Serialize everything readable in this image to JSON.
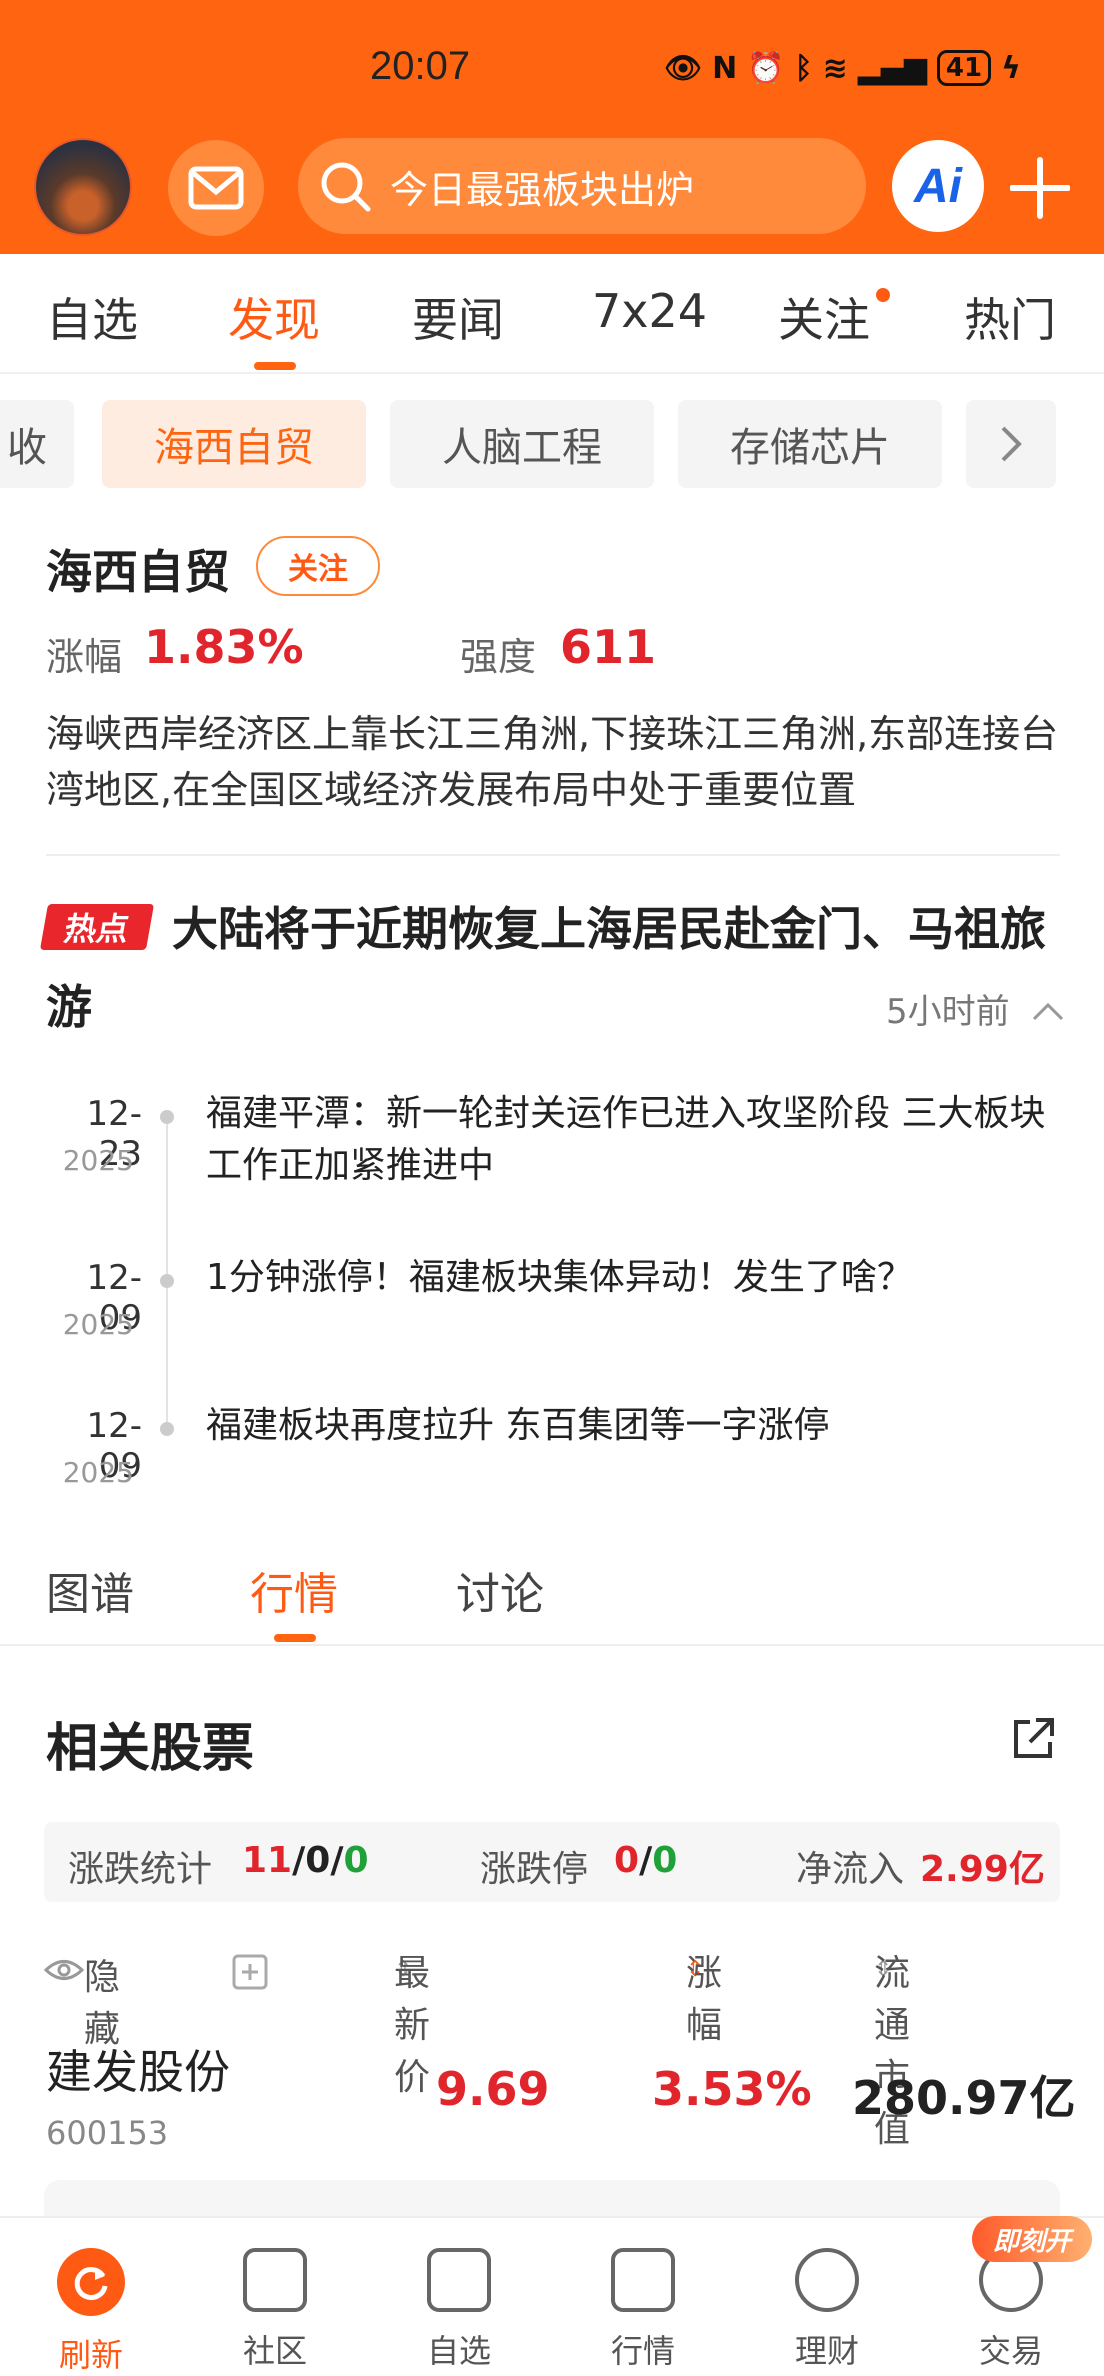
{
  "status": {
    "time": "20:07",
    "battery": "41"
  },
  "search": {
    "placeholder": "今日最强板块出炉"
  },
  "ai_label": "Ai",
  "tabs": [
    {
      "label": "自选"
    },
    {
      "label": "发现"
    },
    {
      "label": "要闻"
    },
    {
      "label": "7x24"
    },
    {
      "label": "关注"
    },
    {
      "label": "热门"
    }
  ],
  "chips": [
    "收",
    "海西自贸",
    "人脑工程",
    "存储芯片"
  ],
  "sector": {
    "name": "海西自贸",
    "follow": "关注",
    "rise_label": "涨幅",
    "rise_value": "1.83%",
    "strength_label": "强度",
    "strength_value": "611",
    "description": "海峡西岸经济区上靠长江三角洲,下接珠江三角洲,东部连接台湾地区,在全国区域经济发展布局中处于重要位置"
  },
  "hot": {
    "tag": "热点",
    "title": "大陆将于近期恢复上海居民赴金门、马祖旅游",
    "time": "5小时前"
  },
  "timeline": [
    {
      "date": "12-23",
      "year": "2025",
      "text": "福建平潭：新一轮封关运作已进入攻坚阶段 三大板块工作正加紧推进中"
    },
    {
      "date": "12-09",
      "year": "2025",
      "text": "1分钟涨停！福建板块集体异动！发生了啥？"
    },
    {
      "date": "12-09",
      "year": "2025",
      "text": "福建板块再度拉升 东百集团等一字涨停"
    }
  ],
  "subtabs": [
    "图谱",
    "行情",
    "讨论"
  ],
  "related": {
    "title": "相关股票",
    "stat_label": "涨跌统计",
    "stat_up": "11",
    "stat_flat": "0",
    "stat_down": "0",
    "limit_label": "涨跌停",
    "limit_up": "0",
    "limit_down": "0",
    "inflow_label": "净流入",
    "inflow_value": "2.99亿",
    "sep": "/"
  },
  "table_header": {
    "hide": "隐藏",
    "price": "最新价",
    "change": "涨幅",
    "cap": "流通市值"
  },
  "stocks": [
    {
      "name": "建发股份",
      "code": "600153",
      "price": "9.69",
      "change": "3.53%",
      "cap": "280.97亿"
    }
  ],
  "nav": [
    {
      "label": "刷新"
    },
    {
      "label": "社区"
    },
    {
      "label": "自选"
    },
    {
      "label": "行情"
    },
    {
      "label": "理财"
    },
    {
      "label": "交易"
    }
  ],
  "nav_badge": "即刻开"
}
